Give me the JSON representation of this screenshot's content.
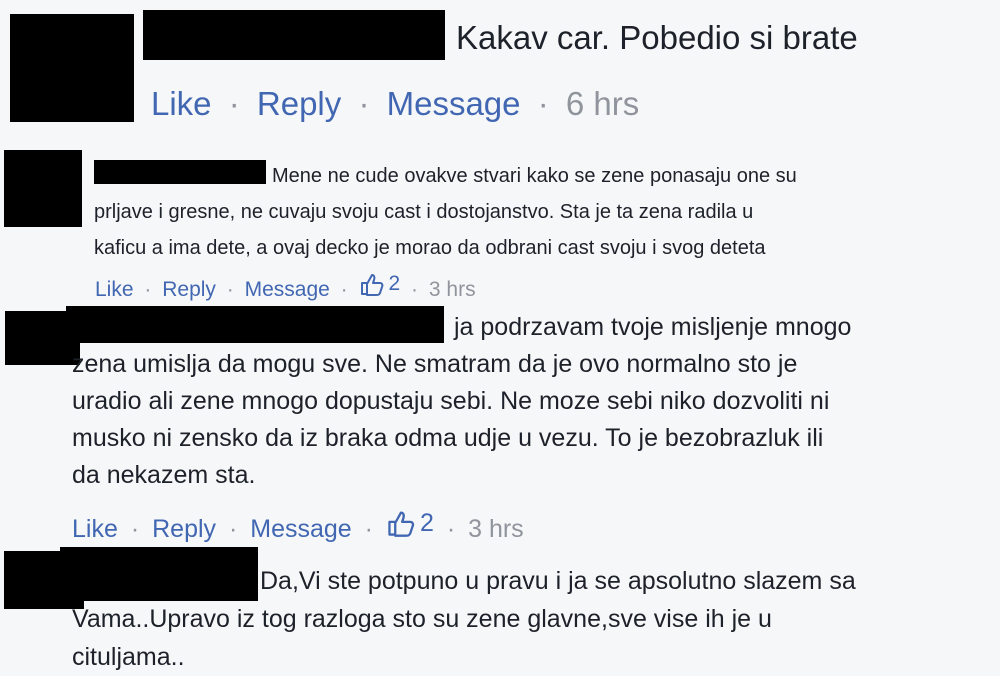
{
  "comments": [
    {
      "text": "Kakav car. Pobedio si brate",
      "actions": {
        "like": "Like",
        "reply": "Reply",
        "message": "Message",
        "time": "6 hrs"
      }
    },
    {
      "text": "Mene ne cude ovakve stvari kako se zene ponasaju one su\nprljave i gresne, ne cuvaju svoju cast i dostojanstvo. Sta je ta zena radila u\nkaficu a ima dete, a ovaj decko je morao da odbrani cast svoju i svog deteta",
      "actions": {
        "like": "Like",
        "reply": "Reply",
        "message": "Message",
        "likes": "2",
        "time": "3 hrs"
      }
    },
    {
      "text": "ja podrzavam tvoje misljenje mnogo\nzena umislja da mogu sve. Ne smatram da je ovo normalno sto je\nuradio ali zene mnogo dopustaju sebi. Ne moze sebi niko dozvoliti ni\nmusko ni zensko da iz braka odma udje u vezu. To je bezobrazluk ili\nda nekazem sta.",
      "actions": {
        "like": "Like",
        "reply": "Reply",
        "message": "Message",
        "likes": "2",
        "time": "3 hrs"
      }
    },
    {
      "text": "Da,Vi ste potpuno u pravu i ja se apsolutno slazem sa\nVama..Upravo iz tog razloga sto su zene glavne,sve vise ih je u\ncituljama.."
    }
  ],
  "separator": "·",
  "colors": {
    "link": "#4267b2",
    "meta": "#90949c",
    "text": "#1d2129",
    "background": "#f6f7f9"
  },
  "icons": {
    "likes": "thumbs-up-icon"
  }
}
